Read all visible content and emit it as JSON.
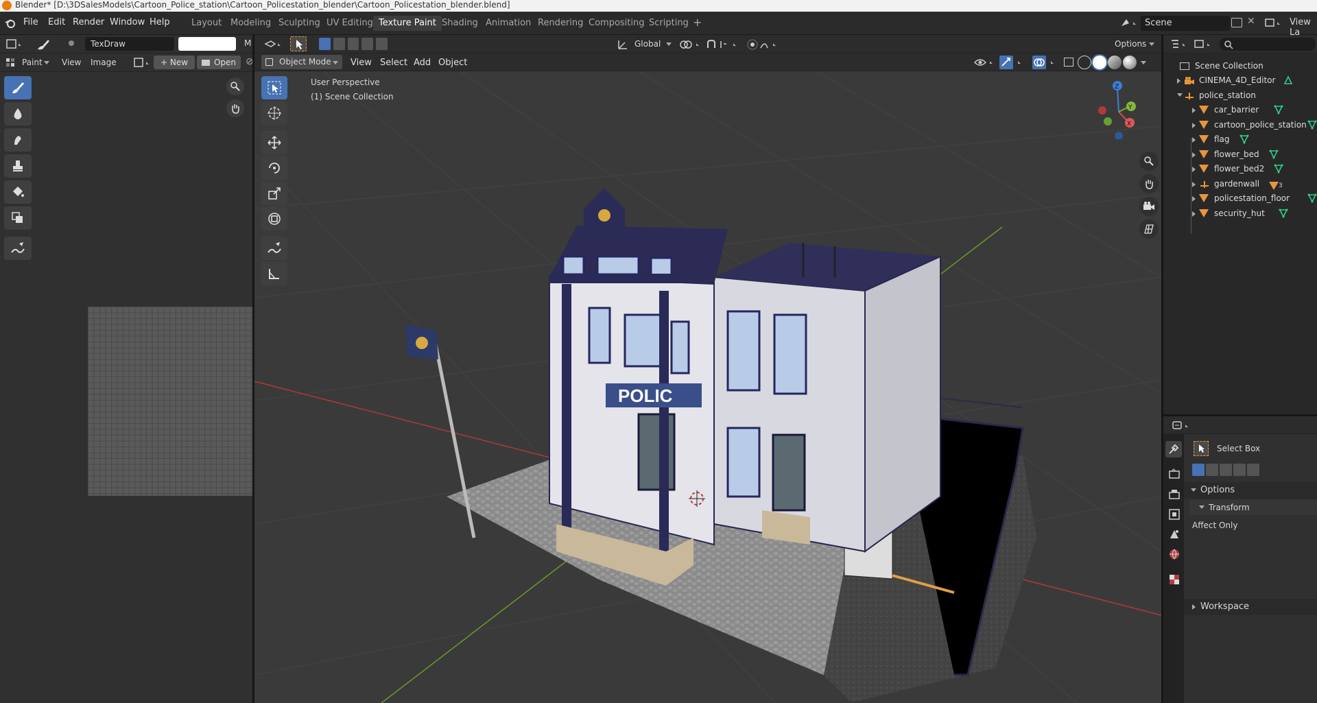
{
  "titlebar": {
    "title": "Blender* [D:\\3DSalesModels\\Cartoon_Police_station\\Cartoon_Policestation_blender\\Cartoon_Policestation_blender.blend]"
  },
  "menus": [
    "File",
    "Edit",
    "Render",
    "Window",
    "Help"
  ],
  "workspace_tabs": [
    "Layout",
    "Modeling",
    "Sculpting",
    "UV Editing",
    "Texture Paint",
    "Shading",
    "Animation",
    "Rendering",
    "Compositing",
    "Scripting"
  ],
  "active_tab": "Texture Paint",
  "scene": {
    "label": "Scene",
    "view_layer": "View La"
  },
  "image_editor": {
    "brush_name": "TexDraw",
    "mode": "Paint",
    "menu_view": "View",
    "menu_image": "Image",
    "new_label": "New",
    "open_label": "Open",
    "trunc_letter": "M"
  },
  "viewport": {
    "mode": "Object Mode",
    "menus": [
      "View",
      "Select",
      "Add",
      "Object"
    ],
    "orientation": "Global",
    "options": "Options",
    "perspective": "User Perspective",
    "collection": "(1) Scene Collection",
    "axis_x": "X",
    "axis_y": "Y",
    "axis_z": "Z",
    "sign_text": "POLIC"
  },
  "outliner": {
    "root": "Scene Collection",
    "items": [
      {
        "name": "CINEMA_4D_Editor",
        "level": 1,
        "type": "camera"
      },
      {
        "name": "police_station",
        "level": 1,
        "type": "empty"
      },
      {
        "name": "car_barrier",
        "level": 2,
        "type": "mesh"
      },
      {
        "name": "cartoon_police_station",
        "level": 2,
        "type": "mesh"
      },
      {
        "name": "flag",
        "level": 2,
        "type": "mesh"
      },
      {
        "name": "flower_bed",
        "level": 2,
        "type": "mesh"
      },
      {
        "name": "flower_bed2",
        "level": 2,
        "type": "mesh"
      },
      {
        "name": "gardenwall",
        "level": 2,
        "type": "empty"
      },
      {
        "name": "policestation_floor",
        "level": 2,
        "type": "mesh"
      },
      {
        "name": "security_hut",
        "level": 2,
        "type": "mesh"
      }
    ],
    "gardenwall_badge": "3"
  },
  "properties": {
    "tool": "Select Box",
    "options": "Options",
    "transform": "Transform",
    "affect_only": "Affect Only",
    "workspace": "Workspace"
  },
  "colors": {
    "accent": "#4772b3",
    "active_tab": "#3d3d3d",
    "mesh_icon": "#e8953a",
    "vertex_green": "#33cc88"
  }
}
